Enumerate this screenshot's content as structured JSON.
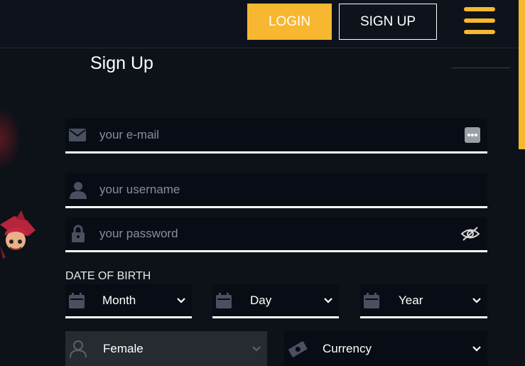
{
  "header": {
    "login_label": "LOGIN",
    "signup_label": "SIGN UP"
  },
  "form": {
    "title": "Sign Up",
    "email_placeholder": "your e-mail",
    "username_placeholder": "your username",
    "password_placeholder": "your password",
    "dob_label": "DATE OF BIRTH",
    "month_label": "Month",
    "day_label": "Day",
    "year_label": "Year",
    "gender_label": "Female",
    "currency_label": "Currency"
  },
  "colors": {
    "accent": "#f8b731",
    "background": "#0d1118",
    "field_background": "#080c14",
    "placeholder": "#8a8e96",
    "icon": "#4a5060"
  },
  "icons": [
    "menu-icon",
    "envelope-icon",
    "more-dots-icon",
    "user-icon",
    "lock-icon",
    "eye-slash-icon",
    "calendar-icon",
    "chevron-down-icon",
    "money-icon"
  ]
}
